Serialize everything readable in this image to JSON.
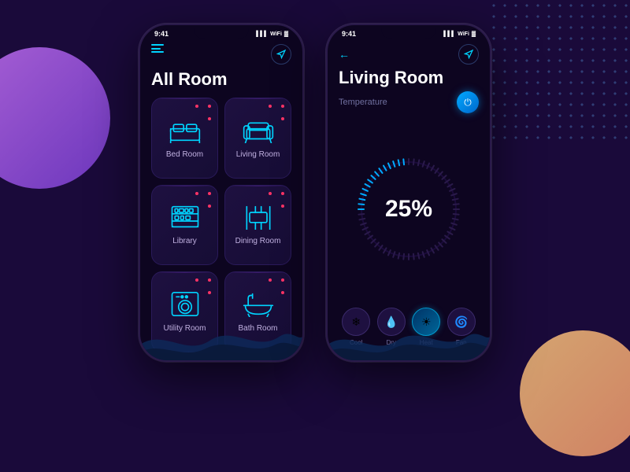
{
  "background": {
    "color": "#1a0a3a"
  },
  "left_phone": {
    "status_time": "9:41",
    "title": "All Room",
    "rooms": [
      {
        "id": "bedroom",
        "name": "Bed Room",
        "icon": "bed"
      },
      {
        "id": "livingroom",
        "name": "Living Room",
        "icon": "sofa"
      },
      {
        "id": "library",
        "name": "Library",
        "icon": "bookshelf"
      },
      {
        "id": "diningroom",
        "name": "Dining Room",
        "icon": "dining"
      },
      {
        "id": "utilityroom",
        "name": "Utility Room",
        "icon": "washer"
      },
      {
        "id": "bathroom",
        "name": "Bath Room",
        "icon": "bath"
      }
    ]
  },
  "right_phone": {
    "status_time": "9:41",
    "title": "Living Room",
    "temp_label": "Temperature",
    "percent": "25%",
    "ac_modes": [
      {
        "id": "cool",
        "label": "Cool",
        "icon": "❄",
        "active": false
      },
      {
        "id": "dry",
        "label": "Dry",
        "icon": "💧",
        "active": false
      },
      {
        "id": "heat",
        "label": "Heat",
        "icon": "☀",
        "active": true
      },
      {
        "id": "fan",
        "label": "Fan",
        "icon": "🌀",
        "active": false
      }
    ]
  }
}
